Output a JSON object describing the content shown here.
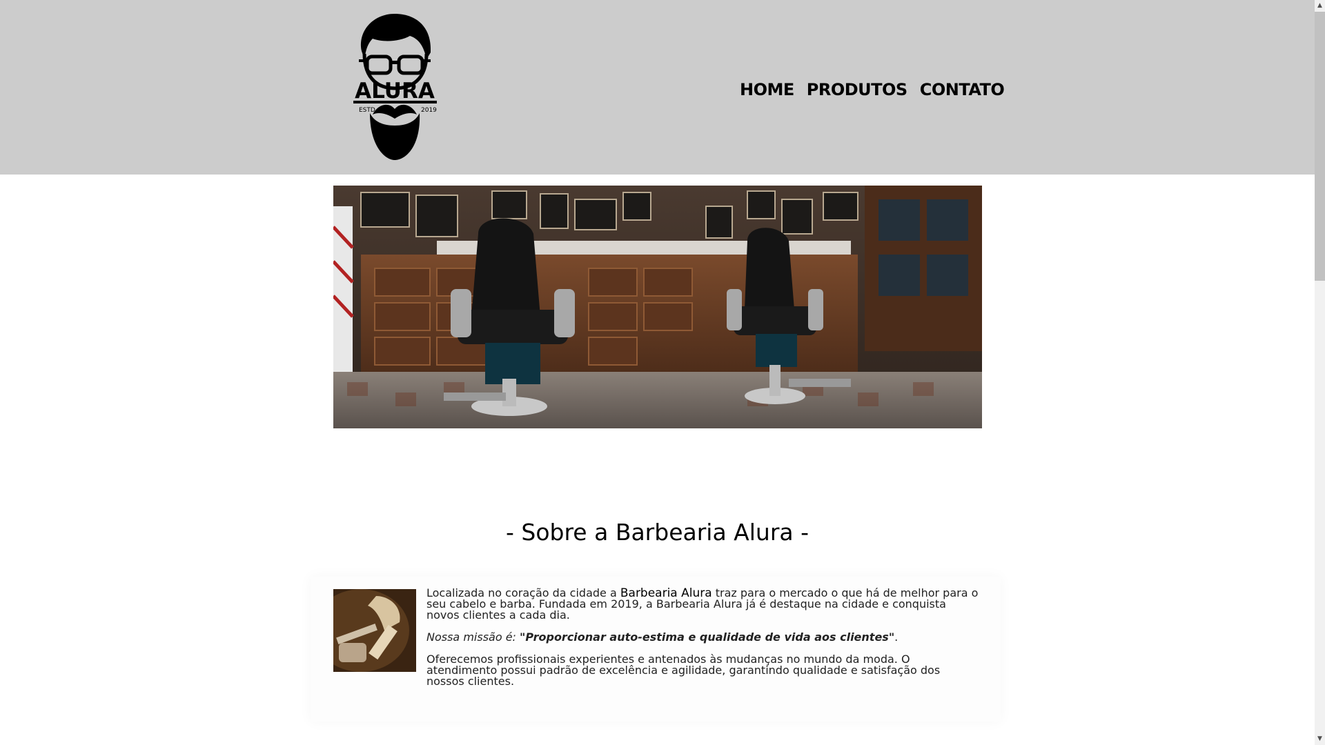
{
  "logo": {
    "brand": "ALURA",
    "estd": "ESTD",
    "year": "2019"
  },
  "nav": {
    "items": [
      {
        "label": "HOME"
      },
      {
        "label": "PRODUTOS"
      },
      {
        "label": "CONTATO"
      }
    ]
  },
  "about": {
    "title": "- Sobre a Barbearia Alura -",
    "p1_before": "Localizada no coração da cidade a ",
    "p1_brand": "Barbearia Alura",
    "p1_after": " traz para o mercado o que há de melhor para o seu cabelo e barba. Fundada em 2019, a Barbearia Alura já é destaque na cidade e conquista novos clientes a cada dia.",
    "p2_lead": "Nossa missão é: ",
    "p2_mission": "\"Proporcionar auto-estima e qualidade de vida aos clientes\"",
    "p2_end": ".",
    "p3": "Oferecemos profissionais experientes e antenados às mudanças no mundo da moda. O atendimento possui padrão de excelência e agilidade, garantindo qualidade e satisfação dos nossos clientes."
  },
  "colors": {
    "header_bg": "#cccccc",
    "page_bg": "#ffffff",
    "text": "#000000"
  },
  "icons": {
    "scroll_up": "▲",
    "scroll_down": "▼"
  }
}
